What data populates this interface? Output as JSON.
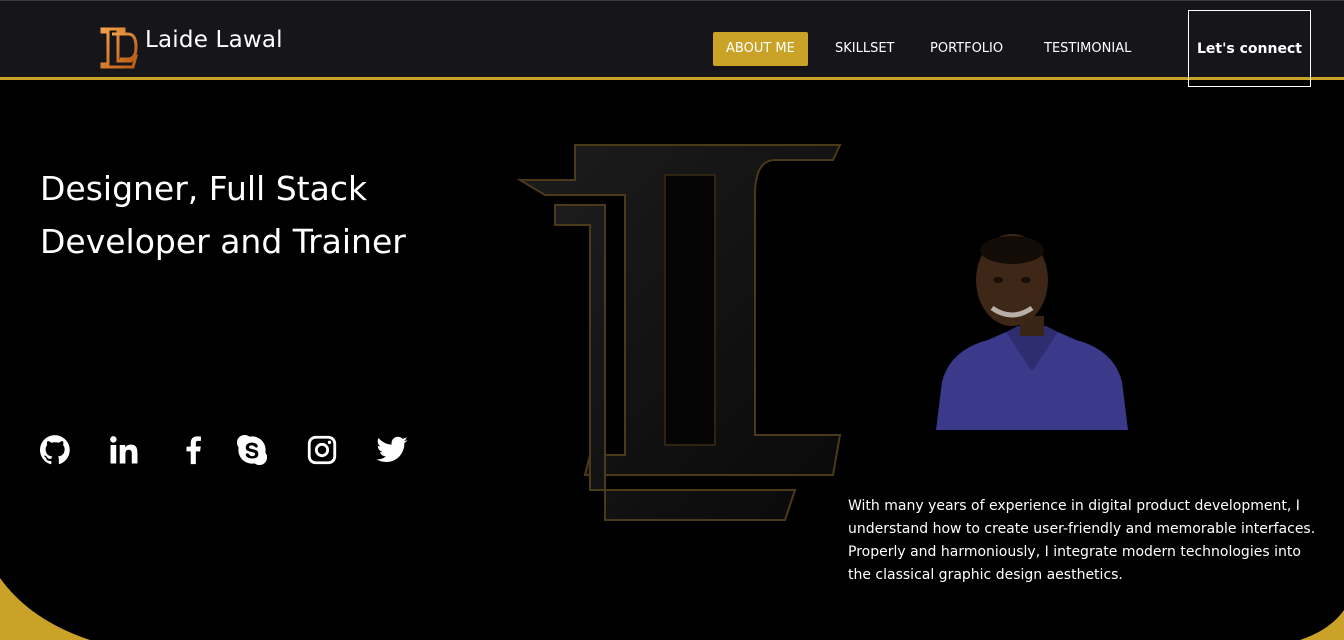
{
  "brand": {
    "name": "Laide Lawal",
    "logo_icon": "ld-monogram-icon"
  },
  "nav": {
    "items": [
      {
        "label": "ABOUT ME",
        "active": true
      },
      {
        "label": "SKILLSET",
        "active": false
      },
      {
        "label": "PORTFOLIO",
        "active": false
      },
      {
        "label": "TESTIMONIAL",
        "active": false
      }
    ],
    "cta_label": "Let's connect"
  },
  "hero": {
    "title_line1": "Designer, Full Stack",
    "title_line2": "Developer and Trainer"
  },
  "about": {
    "text": "With many years of experience in digital product development, I understand how to create user-friendly and memorable interfaces. Properly and harmoniously, I integrate modern technologies into the classical graphic design aesthetics."
  },
  "social": {
    "icons": [
      "github-icon",
      "linkedin-icon",
      "facebook-icon",
      "skype-icon",
      "instagram-icon",
      "twitter-icon"
    ]
  },
  "colors": {
    "accent": "#c9a227",
    "header_bg": "#16161a",
    "page_bg": "#000000",
    "logo_orange": "#e8822a"
  }
}
